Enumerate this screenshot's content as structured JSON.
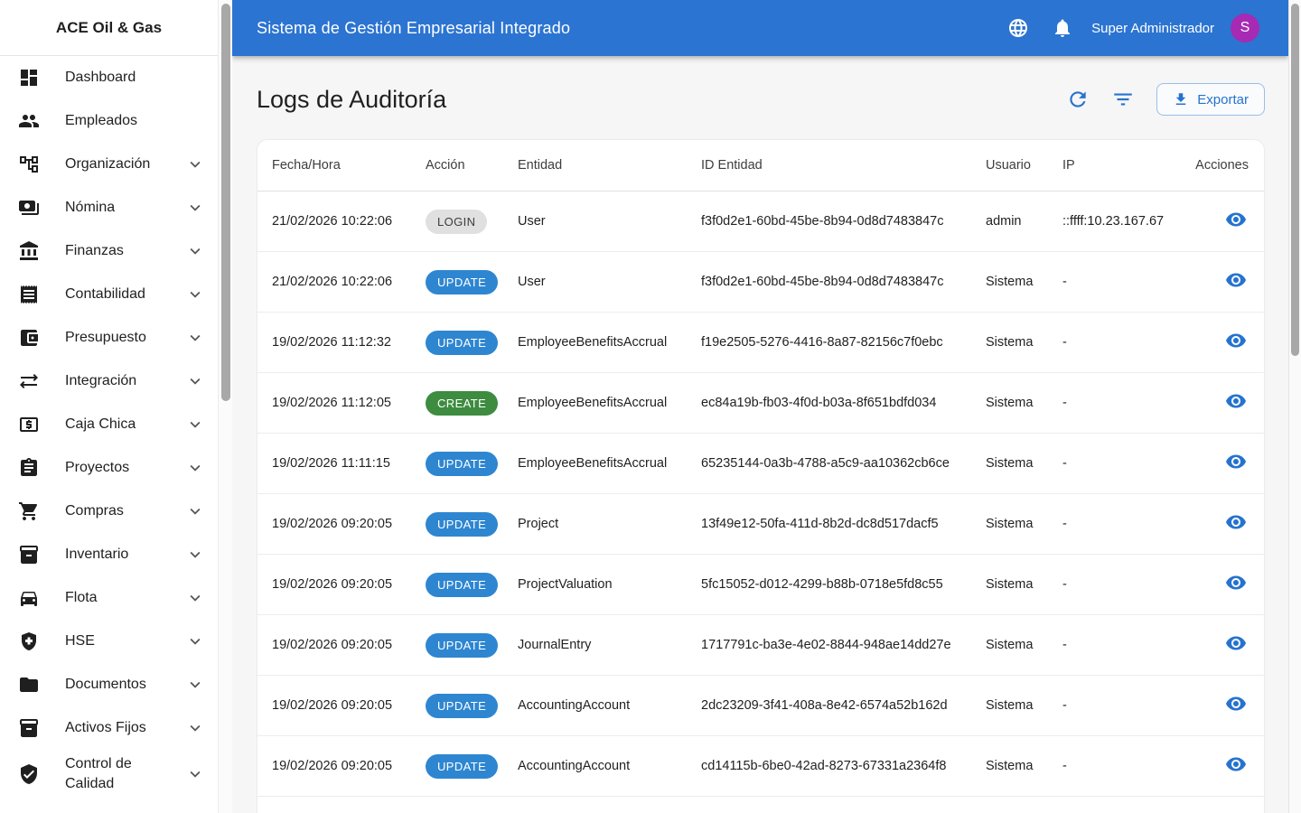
{
  "sidebar": {
    "brand": "ACE Oil & Gas",
    "items": [
      {
        "label": "Dashboard",
        "icon": "dashboard-icon",
        "expandable": false
      },
      {
        "label": "Empleados",
        "icon": "people-icon",
        "expandable": false
      },
      {
        "label": "Organización",
        "icon": "org-tree-icon",
        "expandable": true
      },
      {
        "label": "Nómina",
        "icon": "payments-icon",
        "expandable": true
      },
      {
        "label": "Finanzas",
        "icon": "bank-icon",
        "expandable": true
      },
      {
        "label": "Contabilidad",
        "icon": "receipt-icon",
        "expandable": true
      },
      {
        "label": "Presupuesto",
        "icon": "wallet-icon",
        "expandable": true
      },
      {
        "label": "Integración",
        "icon": "sync-alt-icon",
        "expandable": true
      },
      {
        "label": "Caja Chica",
        "icon": "cash-box-icon",
        "expandable": true
      },
      {
        "label": "Proyectos",
        "icon": "clipboard-icon",
        "expandable": true
      },
      {
        "label": "Compras",
        "icon": "cart-icon",
        "expandable": true
      },
      {
        "label": "Inventario",
        "icon": "inventory-icon",
        "expandable": true
      },
      {
        "label": "Flota",
        "icon": "car-icon",
        "expandable": true
      },
      {
        "label": "HSE",
        "icon": "health-safety-icon",
        "expandable": true
      },
      {
        "label": "Documentos",
        "icon": "folder-icon",
        "expandable": true
      },
      {
        "label": "Activos Fijos",
        "icon": "inventory-icon",
        "expandable": true
      },
      {
        "label": "Control de Calidad",
        "icon": "verified-shield-icon",
        "expandable": true
      }
    ]
  },
  "appbar": {
    "title": "Sistema de Gestión Empresarial Integrado",
    "user_name": "Super Administrador",
    "avatar_initial": "S",
    "icons": [
      "globe-icon",
      "bell-icon"
    ]
  },
  "page": {
    "title": "Logs de Auditoría",
    "export_label": "Exportar",
    "action_icons": [
      "refresh-icon",
      "filter-icon",
      "download-icon"
    ]
  },
  "table": {
    "columns": [
      "Fecha/Hora",
      "Acción",
      "Entidad",
      "ID Entidad",
      "Usuario",
      "IP",
      "Acciones"
    ],
    "rows": [
      {
        "datetime": "21/02/2026 10:22:06",
        "action": "LOGIN",
        "action_type": "login",
        "entity": "User",
        "entity_id": "f3f0d2e1-60bd-45be-8b94-0d8d7483847c",
        "user": "admin",
        "ip": "::ffff:10.23.167.67"
      },
      {
        "datetime": "21/02/2026 10:22:06",
        "action": "UPDATE",
        "action_type": "update",
        "entity": "User",
        "entity_id": "f3f0d2e1-60bd-45be-8b94-0d8d7483847c",
        "user": "Sistema",
        "ip": "-"
      },
      {
        "datetime": "19/02/2026 11:12:32",
        "action": "UPDATE",
        "action_type": "update",
        "entity": "EmployeeBenefitsAccrual",
        "entity_id": "f19e2505-5276-4416-8a87-82156c7f0ebc",
        "user": "Sistema",
        "ip": "-"
      },
      {
        "datetime": "19/02/2026 11:12:05",
        "action": "CREATE",
        "action_type": "create",
        "entity": "EmployeeBenefitsAccrual",
        "entity_id": "ec84a19b-fb03-4f0d-b03a-8f651bdfd034",
        "user": "Sistema",
        "ip": "-"
      },
      {
        "datetime": "19/02/2026 11:11:15",
        "action": "UPDATE",
        "action_type": "update",
        "entity": "EmployeeBenefitsAccrual",
        "entity_id": "65235144-0a3b-4788-a5c9-aa10362cb6ce",
        "user": "Sistema",
        "ip": "-"
      },
      {
        "datetime": "19/02/2026 09:20:05",
        "action": "UPDATE",
        "action_type": "update",
        "entity": "Project",
        "entity_id": "13f49e12-50fa-411d-8b2d-dc8d517dacf5",
        "user": "Sistema",
        "ip": "-"
      },
      {
        "datetime": "19/02/2026 09:20:05",
        "action": "UPDATE",
        "action_type": "update",
        "entity": "ProjectValuation",
        "entity_id": "5fc15052-d012-4299-b88b-0718e5fd8c55",
        "user": "Sistema",
        "ip": "-"
      },
      {
        "datetime": "19/02/2026 09:20:05",
        "action": "UPDATE",
        "action_type": "update",
        "entity": "JournalEntry",
        "entity_id": "1717791c-ba3e-4e02-8844-948ae14dd27e",
        "user": "Sistema",
        "ip": "-"
      },
      {
        "datetime": "19/02/2026 09:20:05",
        "action": "UPDATE",
        "action_type": "update",
        "entity": "AccountingAccount",
        "entity_id": "2dc23209-3f41-408a-8e42-6574a52b162d",
        "user": "Sistema",
        "ip": "-"
      },
      {
        "datetime": "19/02/2026 09:20:05",
        "action": "UPDATE",
        "action_type": "update",
        "entity": "AccountingAccount",
        "entity_id": "cd14115b-6be0-42ad-8273-67331a2364f8",
        "user": "Sistema",
        "ip": "-"
      }
    ]
  },
  "colors": {
    "appbar": "#2c74d1",
    "accent": "#2673cf",
    "avatar": "#a62ab3",
    "badge_update": "#2e86d1",
    "badge_create": "#3d8c40",
    "badge_login_bg": "#e0e0e0",
    "page_background": "#f6f6f6"
  }
}
